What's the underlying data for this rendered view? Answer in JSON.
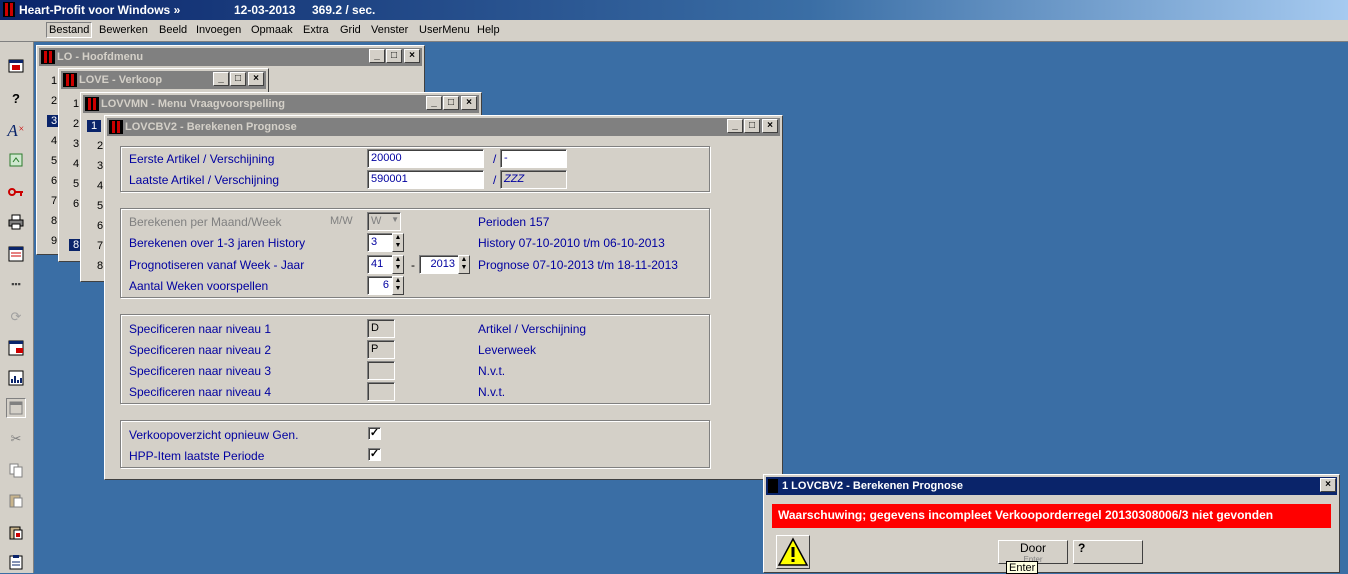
{
  "app": {
    "title": "Heart-Profit voor Windows  »",
    "date": "12-03-2013",
    "speed": "369.2 / sec."
  },
  "menu": [
    "Bestand",
    "Bewerken",
    "Beeld",
    "Invoegen",
    "Opmaak",
    "Extra",
    "Grid",
    "Venster",
    "UserMenu",
    "Help"
  ],
  "windows": {
    "hoofdmenu": {
      "title": "LO - Hoofdmenu",
      "rows": [
        "1",
        "2",
        "3",
        "4",
        "5",
        "6",
        "7",
        "8",
        "9"
      ]
    },
    "verkoop": {
      "title": "LOVE - Verkoop",
      "rows": [
        "1",
        "2",
        "3",
        "4",
        "5",
        "6",
        "7"
      ]
    },
    "vraag": {
      "title": "LOVVMN - Menu Vraagvoorspelling",
      "rows": [
        "1",
        "2",
        "3",
        "4",
        "5",
        "6",
        "7",
        "8"
      ]
    },
    "berekenen": {
      "title": "LOVCBV2 - Berekenen Prognose"
    }
  },
  "form": {
    "eerste_label": "Eerste Artikel / Verschijning",
    "eerste_value": "20000",
    "eerste_suffix": "-",
    "laatste_label": "Laatste Artikel / Verschijning",
    "laatste_value": "590001",
    "laatste_suffix": "ZZZ",
    "slash": "/",
    "per_label": "Berekenen per Maand/Week",
    "per_mw": "M/W",
    "per_value": "W",
    "perioden": "Perioden 157",
    "over_label": "Berekenen over 1-3 jaren History",
    "over_value": "3",
    "history": "History  07-10-2010 t/m 06-10-2013",
    "prognose_label": "Prognotiseren vanaf Week - Jaar",
    "week_value": "41",
    "dash": "-",
    "jaar_value": "2013",
    "prognose_text": "Prognose 07-10-2013 t/m 18-11-2013",
    "weken_label": "Aantal Weken voorspellen",
    "weken_value": "6",
    "spec1_label": "Specificeren naar niveau 1",
    "spec1_value": "D",
    "spec1_desc": "Artikel / Verschijning",
    "spec2_label": "Specificeren naar niveau 2",
    "spec2_value": "P",
    "spec2_desc": "Leverweek",
    "spec3_label": "Specificeren naar niveau 3",
    "spec3_value": "",
    "spec3_desc": "N.v.t.",
    "spec4_label": "Specificeren naar niveau 4",
    "spec4_value": "",
    "spec4_desc": "N.v.t.",
    "chk1_label": "Verkoopoverzicht opnieuw Gen.",
    "chk1_checked": true,
    "chk2_label": "HPP-Item laatste Periode",
    "chk2_checked": true
  },
  "dialog": {
    "title": "1 LOVCBV2 - Berekenen Prognose",
    "message": "Waarschuwing; gegevens incompleet Verkooporderregel 20130308006/3 niet gevonden",
    "door_label": "Door",
    "door_sub": "Enter",
    "tooltip": "Enter",
    "help_glyph": "?"
  },
  "colors": {
    "desktop": "#3a6ea5",
    "label": "#0000a0",
    "warning": "#ff0000"
  }
}
